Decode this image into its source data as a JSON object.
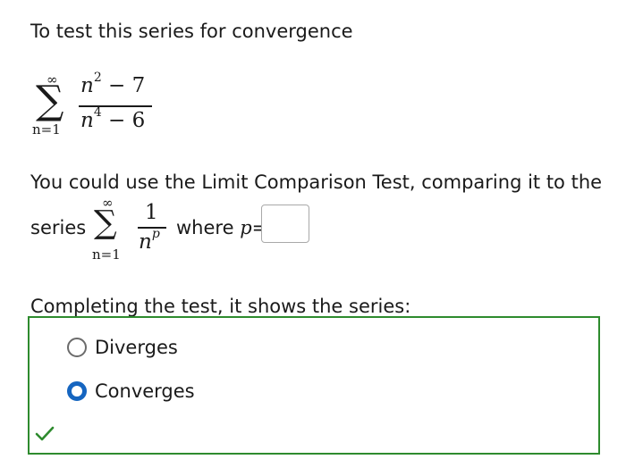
{
  "intro": "To test this series for convergence",
  "series1": {
    "upper": "∞",
    "sigma": "∑",
    "lower": "n=1",
    "numerator_base": "n",
    "numerator_exp": "2",
    "numerator_rest": " − 7",
    "denominator_base": "n",
    "denominator_exp": "4",
    "denominator_rest": " − 6"
  },
  "comparison_text": "You could use the Limit Comparison Test, comparing it to the",
  "series_word": "series",
  "series2": {
    "upper": "∞",
    "sigma": "∑",
    "lower": "n=1",
    "numerator": "1",
    "denominator_base": "n",
    "denominator_exp": "p"
  },
  "where_text": "where ",
  "p_var": "p",
  "equals": "=",
  "p_input": {
    "value": ""
  },
  "completing_text": "Completing the test, it shows the series:",
  "options": [
    {
      "label": "Diverges",
      "checked": false
    },
    {
      "label": "Converges",
      "checked": true
    }
  ],
  "colors": {
    "box_border": "#2e8b2e",
    "radio_checked": "#1565c0",
    "check_mark": "#2e8b2e"
  },
  "icons": {
    "correct": "check-icon"
  }
}
